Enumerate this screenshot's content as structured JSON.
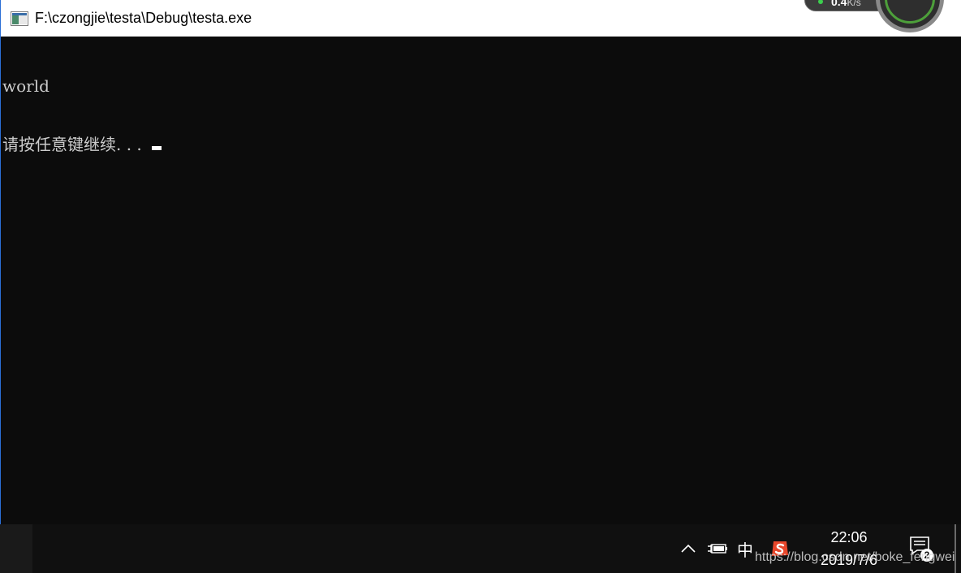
{
  "window": {
    "title": "F:\\czongjie\\testa\\Debug\\testa.exe",
    "icon": "console-window-icon"
  },
  "net_widget": {
    "speed": "0.4",
    "unit": "K/s",
    "indicator_color": "#3ccf4e"
  },
  "console": {
    "lines": [
      "world",
      "请按任意键继续. . . "
    ],
    "text_color": "#cccccc",
    "background": "#0c0c0c"
  },
  "taskbar": {
    "tray_chevron_icon": "chevron-up-icon",
    "power_icon": "battery-plug-icon",
    "ime_label": "中",
    "sogou_icon": "sogou-s-icon",
    "time": "22:06",
    "date": "2019/7/6",
    "notification_count": "2"
  },
  "watermark": "https://blog.csdn.net/boke_fengwei"
}
